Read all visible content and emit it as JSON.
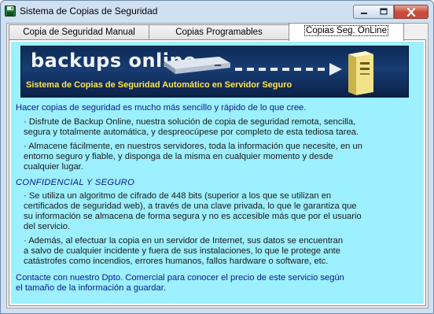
{
  "window": {
    "title": "Sistema de Copias de Seguridad",
    "icon": "floppy-disk-icon",
    "controls": {
      "minimize": "minimize-icon",
      "maximize": "maximize-icon",
      "close": "close-icon"
    }
  },
  "tabs": [
    {
      "label": "Copia de Seguridad Manual",
      "active": false
    },
    {
      "label": "Copias Programables",
      "active": false
    },
    {
      "label": "Copias Seg. OnLine",
      "active": true
    }
  ],
  "banner": {
    "logo": "backups online",
    "subtitle": "Sistema de Copias de Seguridad Automático en Servidor Seguro",
    "colors": {
      "background": "#173d73",
      "subtitle": "#ffe44a"
    }
  },
  "content": {
    "intro": "Hacer copias de seguridad es mucho más sencillo y rápido de lo que cree.",
    "bullet1": [
      "· Disfrute de Backup Online, nuestra solución de copia de seguridad remota, sencilla,",
      "segura y totalmente automática, y despreocúpese por completo de esta tediosa tarea."
    ],
    "bullet2": [
      "· Almacene fácilmente, en nuestros servidores, toda la información que necesite, en un",
      "entorno seguro y fiable, y disponga de la misma en cualquier momento y desde",
      "cualquier lugar."
    ],
    "section_heading": "CONFIDENCIAL Y SEGURO",
    "bullet3": [
      "· Se utiliza un algoritmo de cifrado de 448 bits (superior a los que se utilizan en",
      "certificados de seguridad web), a través de una clave privada, lo que le garantiza que",
      "su información se almacena de forma segura y no es accesible más que por el usuario",
      "del servicio."
    ],
    "bullet4": [
      "· Además, al efectuar la copia en un servidor de Internet, sus datos se encuentran",
      "a salvo de cualquier incidente y fuera de sus instalaciones, lo que le protege ante",
      "catástrofes como incendios, errores humanos, fallos hardware o software, etc."
    ],
    "contact": [
      "Contacte con nuestro Dpto. Comercial para conocer el precio de este servicio según",
      "el tamaño de la información a guardar."
    ]
  },
  "colors": {
    "panel_background": "#9cf0ff",
    "link_text": "#0a1a8c"
  }
}
